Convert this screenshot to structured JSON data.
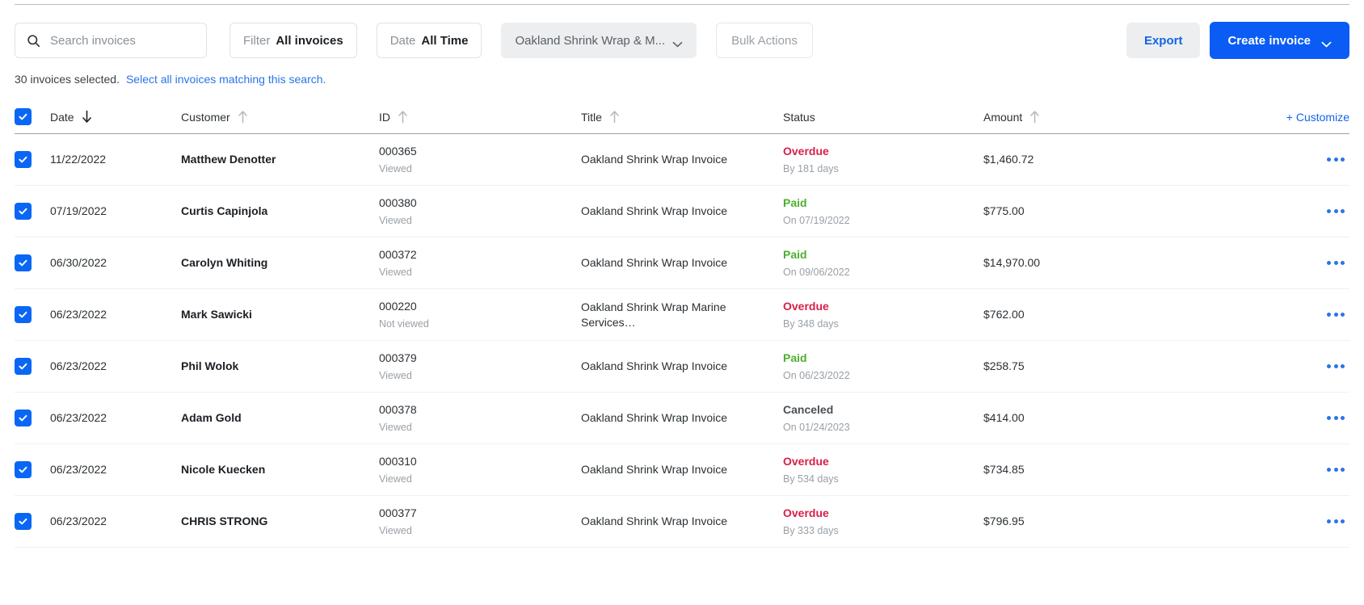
{
  "toolbar": {
    "search": {
      "placeholder": "Search invoices",
      "value": "",
      "icon": "search-icon"
    },
    "filter": {
      "label": "Filter",
      "value": "All invoices"
    },
    "date": {
      "label": "Date",
      "value": "All Time"
    },
    "account": {
      "value": "Oakland Shrink Wrap & M...",
      "icon": "chevron-down-icon"
    },
    "bulk_actions": {
      "label": "Bulk Actions"
    },
    "export": {
      "label": "Export"
    },
    "create_invoice": {
      "label": "Create invoice",
      "icon": "chevron-down-icon"
    }
  },
  "selection": {
    "count_text": "30 invoices selected.",
    "select_all_link": "Select all invoices matching this search."
  },
  "table": {
    "customize_label": "+ Customize",
    "columns": [
      {
        "label": "Date",
        "sort": "desc"
      },
      {
        "label": "Customer",
        "sort": "asc-idle"
      },
      {
        "label": "ID",
        "sort": "asc-idle"
      },
      {
        "label": "Title",
        "sort": "asc-idle"
      },
      {
        "label": "Status",
        "sort": "none"
      },
      {
        "label": "Amount",
        "sort": "asc-idle"
      }
    ],
    "rows": [
      {
        "checked": true,
        "date": "11/22/2022",
        "customer": "Matthew Denotter",
        "id": "000365",
        "id_sub": "Viewed",
        "title": "Oakland Shrink Wrap Invoice",
        "status": "Overdue",
        "status_kind": "overdue",
        "status_sub": "By 181 days",
        "amount": "$1,460.72"
      },
      {
        "checked": true,
        "date": "07/19/2022",
        "customer": "Curtis Capinjola",
        "id": "000380",
        "id_sub": "Viewed",
        "title": "Oakland Shrink Wrap Invoice",
        "status": "Paid",
        "status_kind": "paid",
        "status_sub": "On 07/19/2022",
        "amount": "$775.00"
      },
      {
        "checked": true,
        "date": "06/30/2022",
        "customer": "Carolyn Whiting",
        "id": "000372",
        "id_sub": "Viewed",
        "title": "Oakland Shrink Wrap Invoice",
        "status": "Paid",
        "status_kind": "paid",
        "status_sub": "On 09/06/2022",
        "amount": "$14,970.00"
      },
      {
        "checked": true,
        "date": "06/23/2022",
        "customer": "Mark Sawicki",
        "id": "000220",
        "id_sub": "Not viewed",
        "title": "Oakland Shrink Wrap Marine Services…",
        "status": "Overdue",
        "status_kind": "overdue",
        "status_sub": "By 348 days",
        "amount": "$762.00"
      },
      {
        "checked": true,
        "date": "06/23/2022",
        "customer": "Phil Wolok",
        "id": "000379",
        "id_sub": "Viewed",
        "title": "Oakland Shrink Wrap Invoice",
        "status": "Paid",
        "status_kind": "paid",
        "status_sub": "On 06/23/2022",
        "amount": "$258.75"
      },
      {
        "checked": true,
        "date": "06/23/2022",
        "customer": "Adam Gold",
        "id": "000378",
        "id_sub": "Viewed",
        "title": "Oakland Shrink Wrap Invoice",
        "status": "Canceled",
        "status_kind": "canceled",
        "status_sub": "On 01/24/2023",
        "amount": "$414.00"
      },
      {
        "checked": true,
        "date": "06/23/2022",
        "customer": "Nicole Kuecken",
        "id": "000310",
        "id_sub": "Viewed",
        "title": "Oakland Shrink Wrap Invoice",
        "status": "Overdue",
        "status_kind": "overdue",
        "status_sub": "By 534 days",
        "amount": "$734.85"
      },
      {
        "checked": true,
        "date": "06/23/2022",
        "customer": "CHRIS STRONG",
        "id": "000377",
        "id_sub": "Viewed",
        "title": "Oakland Shrink Wrap Invoice",
        "status": "Overdue",
        "status_kind": "overdue",
        "status_sub": "By 333 days",
        "amount": "$796.95"
      }
    ]
  },
  "colors": {
    "primary": "#0a5cf5",
    "link": "#2a74e8",
    "overdue": "#d6204a",
    "paid": "#4caf2f",
    "canceled": "#4a5056"
  }
}
